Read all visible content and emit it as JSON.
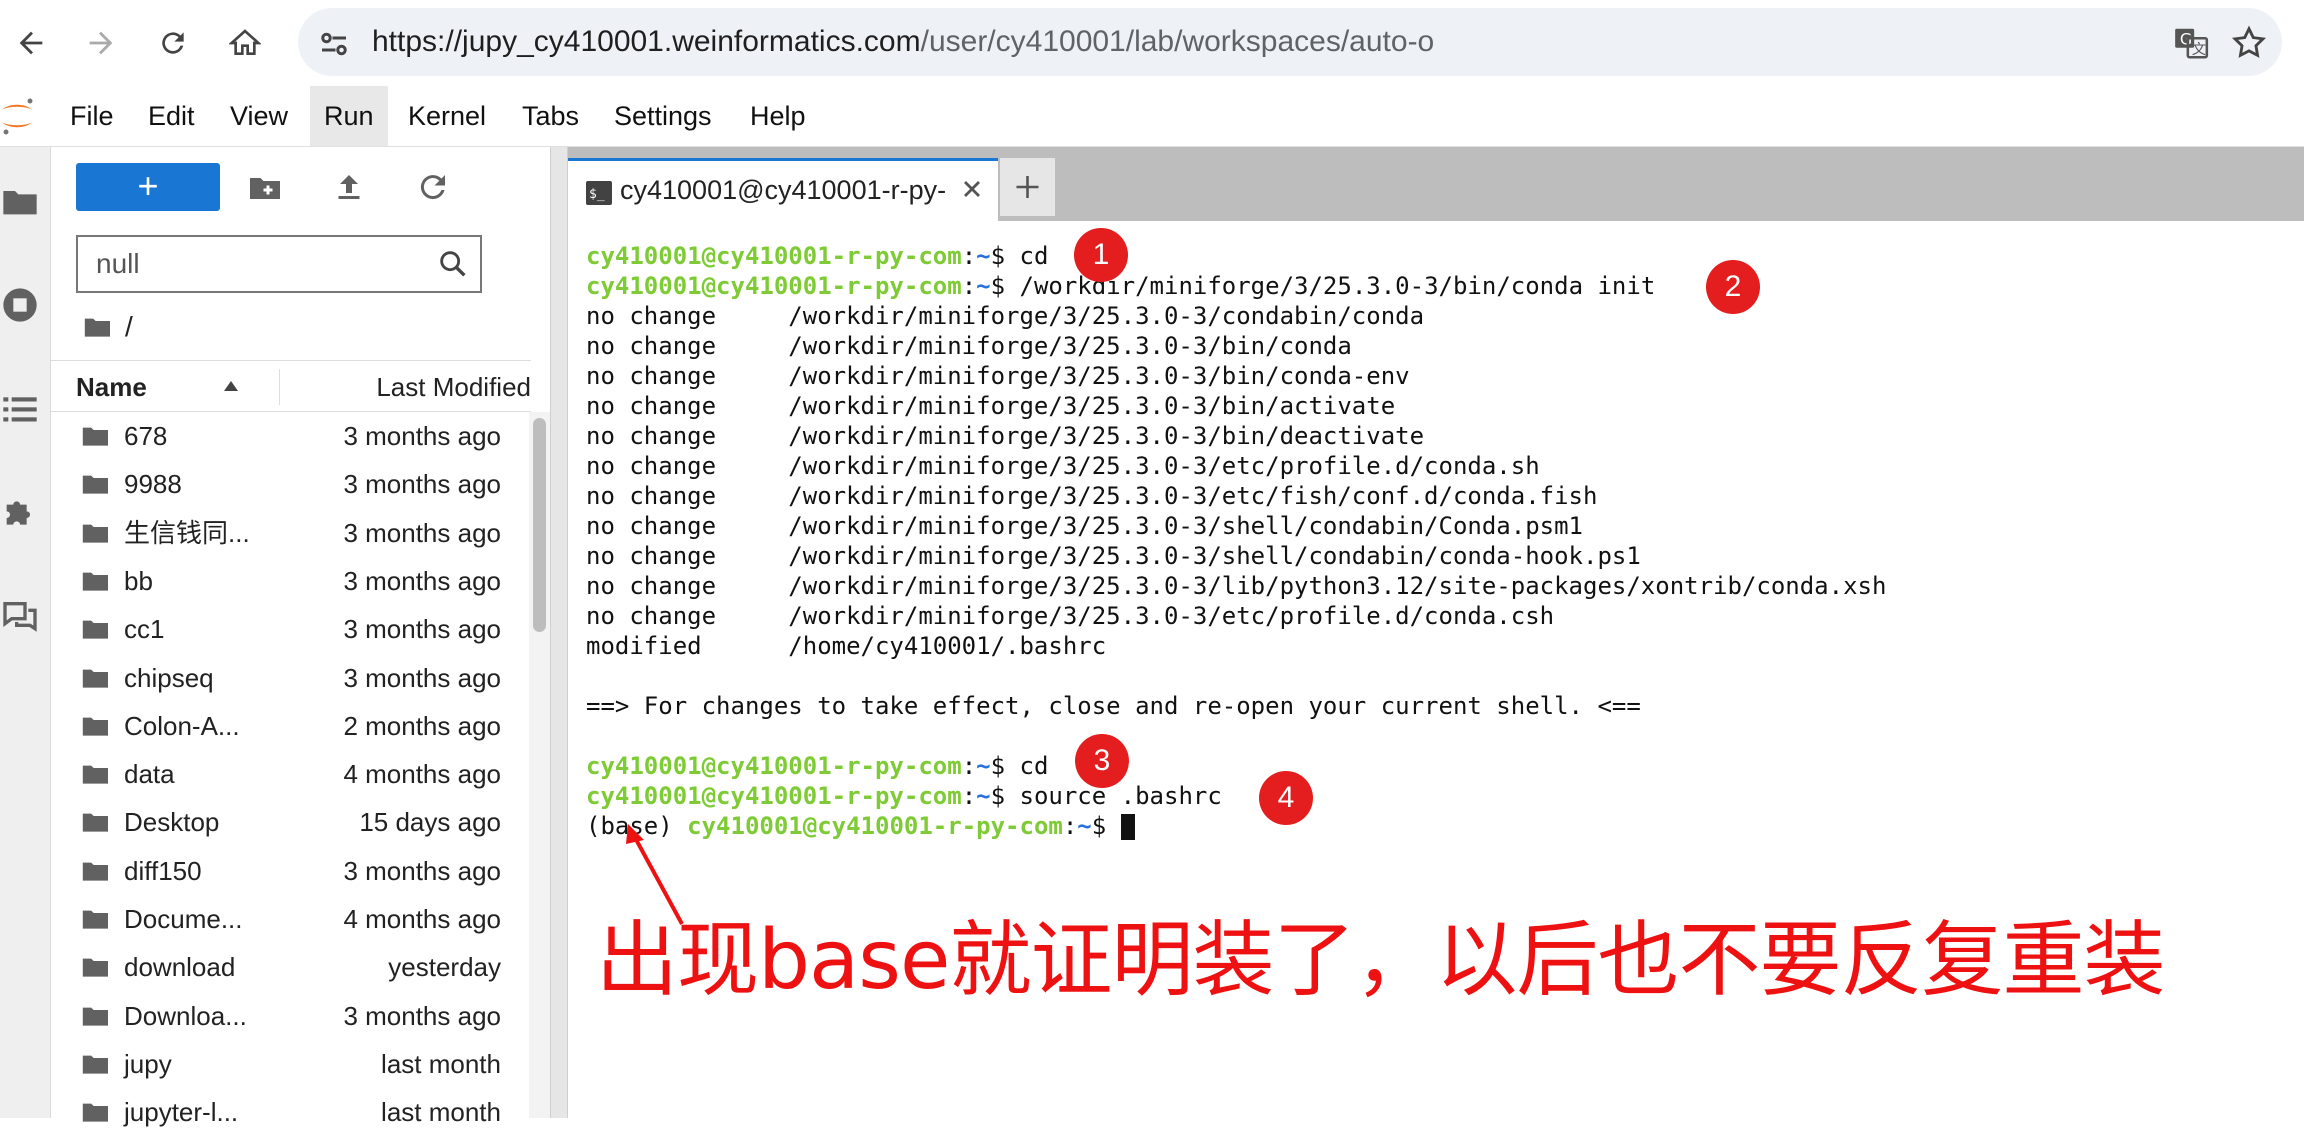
{
  "browser": {
    "url_host": "https://jupy_cy410001.weinformatics.com",
    "url_path": "/user/cy410001/lab/workspaces/auto-o"
  },
  "menu": [
    "File",
    "Edit",
    "View",
    "Run",
    "Kernel",
    "Tabs",
    "Settings",
    "Help"
  ],
  "file_browser": {
    "new_label": "+",
    "filter_value": "null",
    "breadcrumb": "/",
    "col_name": "Name",
    "col_modified": "Last Modified",
    "rows": [
      {
        "name": "678",
        "modified": "3 months ago"
      },
      {
        "name": "9988",
        "modified": "3 months ago"
      },
      {
        "name": "生信钱同...",
        "modified": "3 months ago"
      },
      {
        "name": "bb",
        "modified": "3 months ago"
      },
      {
        "name": "cc1",
        "modified": "3 months ago"
      },
      {
        "name": "chipseq",
        "modified": "3 months ago"
      },
      {
        "name": "Colon-A...",
        "modified": "2 months ago"
      },
      {
        "name": "data",
        "modified": "4 months ago"
      },
      {
        "name": "Desktop",
        "modified": "15 days ago"
      },
      {
        "name": "diff150",
        "modified": "3 months ago"
      },
      {
        "name": "Docume...",
        "modified": "4 months ago"
      },
      {
        "name": "download",
        "modified": "yesterday"
      },
      {
        "name": "Downloa...",
        "modified": "3 months ago"
      },
      {
        "name": "jupy",
        "modified": "last month"
      },
      {
        "name": "jupyter-l...",
        "modified": "last month"
      }
    ]
  },
  "tab": {
    "label": "cy410001@cy410001-r-py-",
    "add": "+"
  },
  "terminal": {
    "user": "cy410001@cy410001-r-py-com",
    "colon": ":",
    "tilde": "~",
    "dollar": "$",
    "cmd1": " cd",
    "cmd2": " /workdir/miniforge/3/25.3.0-3/bin/conda init",
    "outputs": [
      "no change     /workdir/miniforge/3/25.3.0-3/condabin/conda",
      "no change     /workdir/miniforge/3/25.3.0-3/bin/conda",
      "no change     /workdir/miniforge/3/25.3.0-3/bin/conda-env",
      "no change     /workdir/miniforge/3/25.3.0-3/bin/activate",
      "no change     /workdir/miniforge/3/25.3.0-3/bin/deactivate",
      "no change     /workdir/miniforge/3/25.3.0-3/etc/profile.d/conda.sh",
      "no change     /workdir/miniforge/3/25.3.0-3/etc/fish/conf.d/conda.fish",
      "no change     /workdir/miniforge/3/25.3.0-3/shell/condabin/Conda.psm1",
      "no change     /workdir/miniforge/3/25.3.0-3/shell/condabin/conda-hook.ps1",
      "no change     /workdir/miniforge/3/25.3.0-3/lib/python3.12/site-packages/xontrib/conda.xsh",
      "no change     /workdir/miniforge/3/25.3.0-3/etc/profile.d/conda.csh",
      "modified      /home/cy410001/.bashrc"
    ],
    "notice": "==> For changes to take effect, close and re-open your current shell. <==",
    "cmd3": " cd",
    "cmd4": " source .bashrc",
    "base_prefix": "(base) "
  },
  "badges": [
    "1",
    "2",
    "3",
    "4"
  ],
  "annotation": "出现base就证明装了，以后也不要反复重装",
  "colors": {
    "accent": "#1976d2",
    "user_green": "#7ecb35",
    "annotation_red": "#ee1111"
  }
}
